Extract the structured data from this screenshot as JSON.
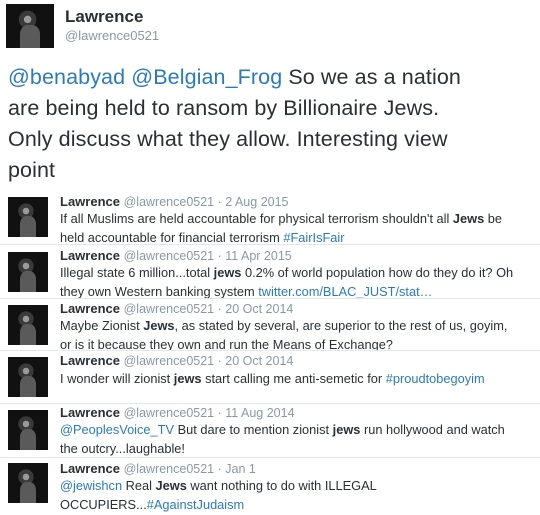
{
  "main": {
    "name": "Lawrence",
    "handle": "@lawrence0521",
    "mention1": "@benabyad",
    "mention2": "@Belgian_Frog",
    "line1_rest": " So we as a nation",
    "line2": "are being held to ransom by Billionaire Jews.",
    "line3": "Only discuss what they allow. Interesting view",
    "line4": "point"
  },
  "tweets": [
    {
      "name": "Lawrence",
      "meta": "@lawrence0521 · 2 Aug 2015",
      "l1a": "If all Muslims are held accountable for physical terrorism shouldn't all ",
      "l1b": "Jews",
      "l1c": " be",
      "l2a": "held accountable for financial terrorism ",
      "l2link": "#FairIsFair"
    },
    {
      "name": "Lawrence",
      "meta": "@lawrence0521 · 11 Apr 2015",
      "l1a": "Illegal state 6 million...total ",
      "l1b": "jews",
      "l1c": " 0.2% of world population how do they do it? Oh",
      "l2a": "they own Western banking system ",
      "l2link": "twitter.com/BLAC_JUST/stat…"
    },
    {
      "name": "Lawrence",
      "meta": "@lawrence0521 · 20 Oct 2014",
      "l1a": "Maybe Zionist ",
      "l1b": "Jews",
      "l1c": ", as stated by several, are superior to the rest of us, goyim,",
      "l2a": "or is it because they own and run the Means of Exchange?",
      "l2link": ""
    },
    {
      "name": "Lawrence",
      "meta": "@lawrence0521 · 20 Oct 2014",
      "l1a": "I wonder will zionist ",
      "l1b": "jews",
      "l1c": " start calling me anti-semetic for ",
      "l1link": "#proudtobegoyim",
      "l2a": "",
      "l2link": ""
    },
    {
      "name": "Lawrence",
      "meta": "@lawrence0521 · 11 Aug 2014",
      "l1linkfirst": "@PeoplesVoice_TV",
      "l1a": " But dare to mention zionist ",
      "l1b": "jews",
      "l1c": " run hollywood and watch",
      "l2a": "the outcry...laughable!",
      "l2link": ""
    },
    {
      "name": "Lawrence",
      "meta": "@lawrence0521 · Jan 1",
      "l1linkfirst": "@jewishcn",
      "l1a": " Real ",
      "l1b": "Jews",
      "l1c": " want nothing to do with ILLEGAL",
      "l2a": "OCCUPIERS...",
      "l2link": "#AgainstJudaism"
    }
  ]
}
